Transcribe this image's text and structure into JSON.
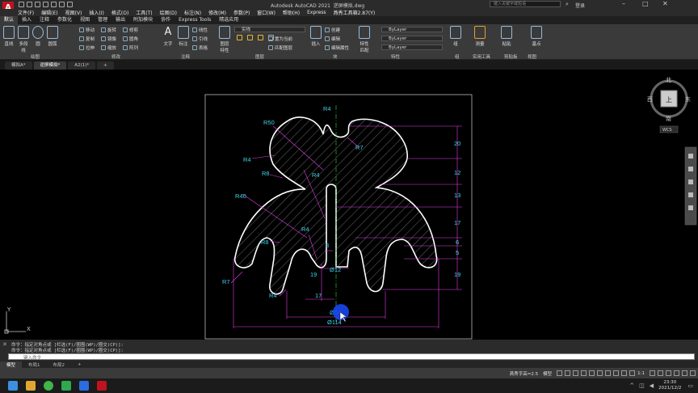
{
  "title_bar": {
    "app_title": "Autodesk AutoCAD 2021",
    "doc_title": "逆屏模拟.dwg",
    "search_placeholder": "键入关键字或短语",
    "login": "登录"
  },
  "menu": [
    "文件(F)",
    "编辑(E)",
    "视图(V)",
    "插入(I)",
    "格式(O)",
    "工具(T)",
    "绘图(D)",
    "标注(N)",
    "修改(M)",
    "参数(P)",
    "窗口(W)",
    "帮助(H)",
    "Express",
    "燕秀工具箱2.87(Y)"
  ],
  "ribbon_tabs": [
    "默认",
    "插入",
    "注释",
    "参数化",
    "视图",
    "管理",
    "输出",
    "附加模块",
    "协作",
    "Express Tools",
    "精选应用"
  ],
  "ribbon": {
    "draw": {
      "label": "绘图",
      "tools": [
        "直线",
        "多段线",
        "圆",
        "圆弧"
      ]
    },
    "modify": {
      "label": "修改",
      "tools": [
        "移动",
        "旋转",
        "修剪",
        "复制",
        "镜像",
        "圆角",
        "拉伸",
        "缩放",
        "阵列"
      ]
    },
    "annotation": {
      "label": "注释",
      "tools": [
        "文字",
        "标注",
        "线性",
        "引线",
        "表格"
      ]
    },
    "layers": {
      "label": "图层",
      "tools": [
        "图层特性",
        "置为当前",
        "匹配图层"
      ],
      "current": "实线"
    },
    "block": {
      "label": "块",
      "tools": [
        "插入",
        "创建",
        "编辑",
        "编辑属性"
      ]
    },
    "properties": {
      "label": "特性",
      "tools": [
        "特性匹配"
      ],
      "color": "ByLayer",
      "linetype": "ByLayer",
      "lineweight": "ByLayer"
    },
    "groups": {
      "label": "组",
      "tools": [
        "组"
      ]
    },
    "utilities": {
      "label": "实用工具",
      "tools": [
        "测量"
      ]
    },
    "clipboard": {
      "label": "剪贴板",
      "tools": [
        "粘贴"
      ]
    },
    "view": {
      "label": "视图",
      "tools": [
        "基点"
      ]
    }
  },
  "doc_tabs": [
    "模拟A*",
    "逆屏模拟*",
    "A2(1)*",
    "+"
  ],
  "drawing": {
    "dims_radius": [
      "R4",
      "R50",
      "R7",
      "R4",
      "R8",
      "R4",
      "R40",
      "R8",
      "R4",
      "R7",
      "R4"
    ],
    "dims_right": [
      "20",
      "12",
      "13",
      "17",
      "6",
      "5",
      "19"
    ],
    "dims_bottom": [
      "8",
      "Ø12",
      "19",
      "17",
      "Ø54",
      "Ø114"
    ]
  },
  "viewcube": {
    "north": "北",
    "south": "南",
    "east": "东",
    "west": "西",
    "top": "上",
    "wcs": "WCS"
  },
  "ucs": {
    "x": "X",
    "y": "Y"
  },
  "command": {
    "history": [
      "命令：指定对角点或 [栏选(F)/圈围(WP)/圈交(CP)]:",
      "命令：指定对角点或 [栏选(F)/圈围(WP)/圈交(CP)]:"
    ],
    "placeholder": "键入命令"
  },
  "layouts": [
    "模型",
    "布局1",
    "布局2",
    "+"
  ],
  "status": {
    "text_style": "燕秀字高=2.5",
    "model": "模型",
    "scale": "1:1"
  },
  "clock": {
    "time": "23:30",
    "date": "2021/12/2"
  }
}
